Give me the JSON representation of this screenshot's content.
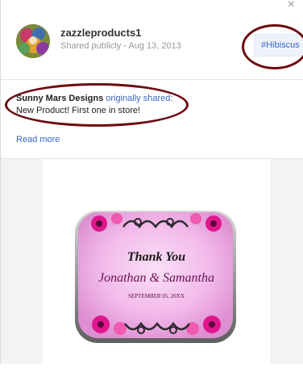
{
  "post": {
    "author": "zazzleproducts1",
    "meta": "Shared publicly - Aug 13, 2013",
    "hashtag": "#Hibiscus",
    "close_glyph": "×",
    "sharer_name": "Sunny Mars Designs",
    "sharer_action": "originally shared:",
    "text": "New Product! First one in store!",
    "read_more": "Read more"
  },
  "product": {
    "title": "Thank You",
    "names": "Jonathan & Samantha",
    "date": "SEPTEMBER 05, 20XX"
  },
  "colors": {
    "link": "#3b66c4",
    "annotation": "#6b0b10",
    "tin_pink": "#f2b9ea",
    "flower_pink": "#e0168d"
  }
}
